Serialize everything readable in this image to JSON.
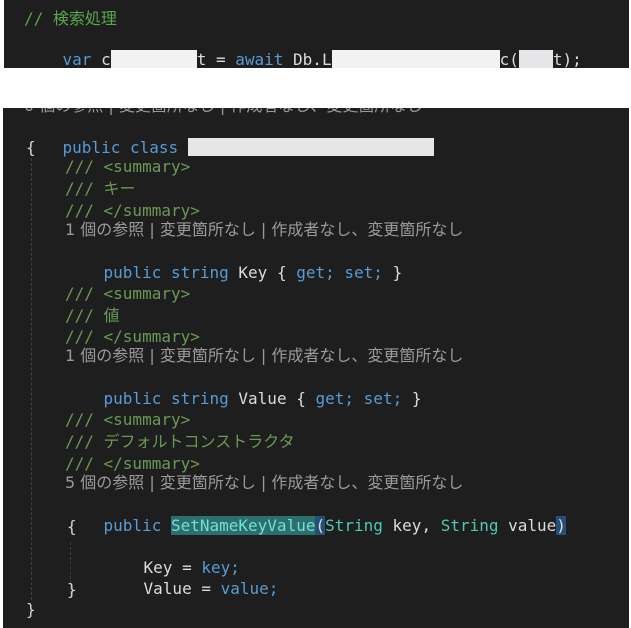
{
  "top": {
    "comment": "// 検索処理",
    "code": {
      "var_kw": "var",
      "part1": " c",
      "part2": "t = ",
      "await_kw": "await",
      "part3": " Db.L",
      "part4": "c(",
      "part5": "t);"
    }
  },
  "class_block": {
    "cut_lens": "0 個の参照 | 変更箇所なし | 作成者なし、変更箇所なし",
    "public_kw": "public",
    "class_kw": "class",
    "open_brace": "{",
    "close_brace": "}",
    "members": [
      {
        "summary_open": "/// <summary>",
        "summary_text": "/// キー",
        "summary_close": "/// </summary>",
        "codelens": "1 個の参照 | 変更箇所なし | 作成者なし、変更箇所なし",
        "decl": {
          "public_kw": "public",
          "type_kw": "string",
          "name": "Key",
          "brace_open": "{",
          "get_kw": "get;",
          "set_kw": "set;",
          "brace_close": "}"
        }
      },
      {
        "summary_open": "/// <summary>",
        "summary_text": "/// 値",
        "summary_close": "/// </summary>",
        "codelens": "1 個の参照 | 変更箇所なし | 作成者なし、変更箇所なし",
        "decl": {
          "public_kw": "public",
          "type_kw": "string",
          "name": "Value",
          "brace_open": "{",
          "get_kw": "get;",
          "set_kw": "set;",
          "brace_close": "}"
        }
      },
      {
        "summary_open": "/// <summary>",
        "summary_text": "/// デフォルトコンストラクタ",
        "summary_close": "/// </summary>",
        "codelens": "5 個の参照 | 変更箇所なし | 作成者なし、変更箇所なし",
        "ctor": {
          "public_kw": "public",
          "name": "SetNameKeyValue",
          "open_paren": "(",
          "type1": "String",
          "param1": " key, ",
          "type2": "String",
          "param2": " value",
          "close_paren": ")",
          "brace_open": "{",
          "body1_left": "Key = ",
          "body1_right": "key;",
          "body2_left": "Value = ",
          "body2_right": "value;",
          "brace_close": "}"
        }
      }
    ]
  }
}
